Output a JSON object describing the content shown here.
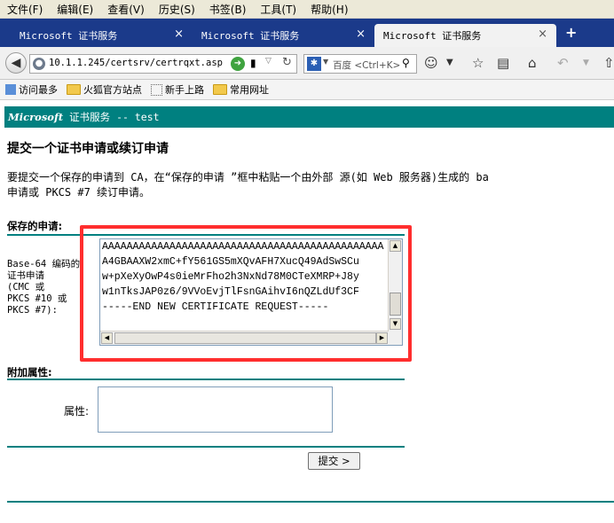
{
  "menu": [
    "文件(F)",
    "编辑(E)",
    "查看(V)",
    "历史(S)",
    "书签(B)",
    "工具(T)",
    "帮助(H)"
  ],
  "tabs": [
    {
      "title": "Microsoft 证书服务",
      "close": "×"
    },
    {
      "title": "Microsoft 证书服务",
      "close": "×"
    },
    {
      "title": "Microsoft 证书服务",
      "close": "×"
    }
  ],
  "new_tab": "+",
  "address": {
    "url": "10.1.1.245/certsrv/certrqxt.asp"
  },
  "search": {
    "engine": "百度",
    "hint": "<Ctrl+K>"
  },
  "bookmarks": [
    "访问最多",
    "火狐官方站点",
    "新手上路",
    "常用网址"
  ],
  "banner": {
    "ms": "Microsoft",
    "rest": " 证书服务 --  test"
  },
  "page": {
    "heading": "提交一个证书申请或续订申请",
    "desc_line1": "要提交一个保存的申请到 CA，在“保存的申请 ”框中粘贴一个由外部 源(如 Web 服务器)生成的 ba",
    "desc_line2": "申请或 PKCS #7 续订申请。",
    "saved_section": "保存的申请:",
    "side_label": "Base-64 编码的\n证书申请\n(CMC 或\nPKCS #10 或\nPKCS #7):",
    "request_lines": [
      "AAAAAAAAAAAAAAAAAAAAAAAAAAAAAAAAAAAAAAAAAAAAAA",
      "A4GBAAXW2xmC+fY561GS5mXQvAFH7XucQ49AdSwSCu",
      "w+pXeXyOwP4s0ieMrFho2h3NxNd78M0CTeXMRP+J8y",
      "w1nTksJAP0z6/9VVoEvjTlFsnGAihvI6nQZLdUf3CF",
      "-----END NEW CERTIFICATE REQUEST-----"
    ],
    "extra_section": "附加属性:",
    "attr_label": "属性:",
    "submit_label": "提交 >"
  }
}
